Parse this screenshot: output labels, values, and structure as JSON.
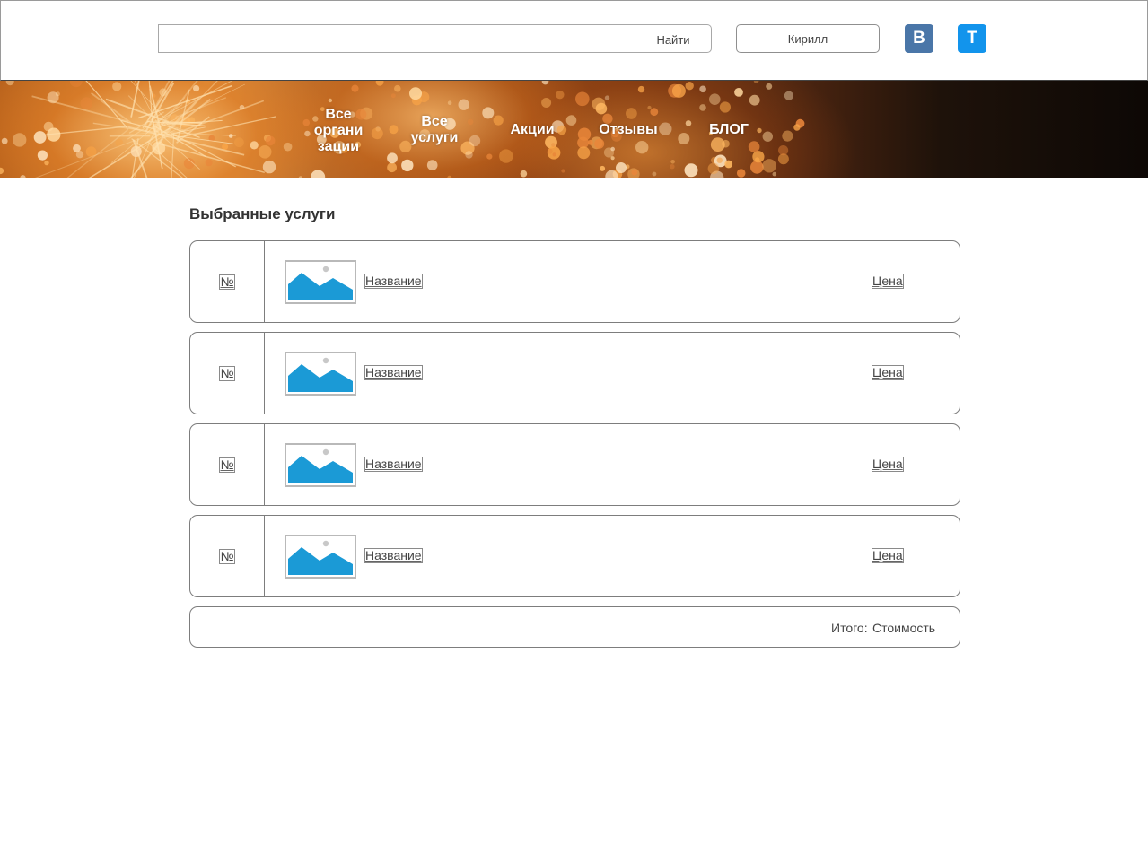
{
  "header": {
    "search": {
      "value": "",
      "placeholder": ""
    },
    "search_button": "Найти",
    "user_button": "Кирилл",
    "social": {
      "vk_label": "B",
      "tg_label": "T",
      "vk_color": "#4a76a8",
      "tg_color": "#1294ec"
    }
  },
  "nav": {
    "orgs": [
      "Все",
      "органи",
      "зации"
    ],
    "services": [
      "Все",
      "услуги"
    ],
    "promos": "Акции",
    "reviews": "Отзывы",
    "blog": "БЛОГ"
  },
  "main": {
    "title": "Выбранные услуги",
    "rows": [
      {
        "num": "№",
        "name": "Название",
        "price": "Цена"
      },
      {
        "num": "№",
        "name": "Название",
        "price": "Цена"
      },
      {
        "num": "№",
        "name": "Название",
        "price": "Цена"
      },
      {
        "num": "№",
        "name": "Название",
        "price": "Цена"
      }
    ],
    "total": {
      "label": "Итого:",
      "value": "Стоимость"
    }
  },
  "colors": {
    "accent_image": "#1b9ad6",
    "border": "#7d7d7d"
  }
}
